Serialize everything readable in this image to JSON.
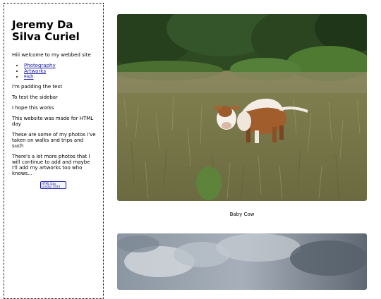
{
  "sidebar": {
    "title": "Jeremy Da Silva Curiel",
    "welcome": "Hiii welcome to my webbed site",
    "nav": [
      {
        "label": "Photography"
      },
      {
        "label": "Artworks"
      },
      {
        "label": "Fish"
      }
    ],
    "paragraphs": [
      "I'm padding the text",
      "To test the sidebar",
      "I hope this works",
      "This website was made for HTML day",
      "These are some of my photos i've taken on walks and trips and such",
      "There's a lot more photos that I will continue to add and maybe I'll add my artworks too who knows..."
    ],
    "badge": {
      "line1": "HTML Day",
      "line2": "London 2024"
    }
  },
  "gallery": [
    {
      "caption": "Baby Cow",
      "subject": "calf in tall grass field"
    },
    {
      "caption": "",
      "subject": "cloudy sky"
    }
  ]
}
